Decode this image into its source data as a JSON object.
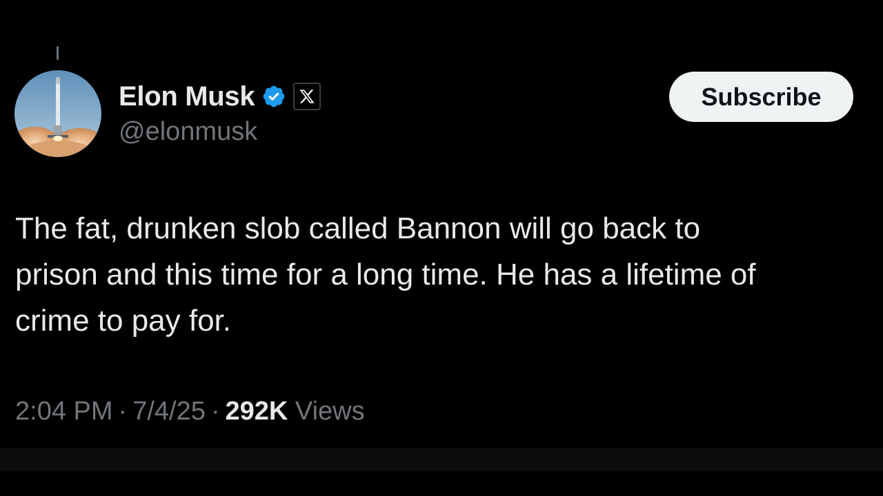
{
  "author": {
    "display_name": "Elon Musk",
    "handle": "@elonmusk",
    "verified": true,
    "verified_color": "#1d9bf0",
    "avatar_icon": "rocket-launch-avatar",
    "affiliation_icon": "x-logo-icon"
  },
  "subscribe": {
    "label": "Subscribe"
  },
  "tweet": {
    "text": "The fat, drunken slob called Bannon will go back to\nprison and this time for a long time. He has a lifetime of\ncrime to pay for."
  },
  "meta": {
    "time": "2:04 PM",
    "separator": "·",
    "date": "7/4/25",
    "views_count": "292K",
    "views_label": "Views"
  }
}
